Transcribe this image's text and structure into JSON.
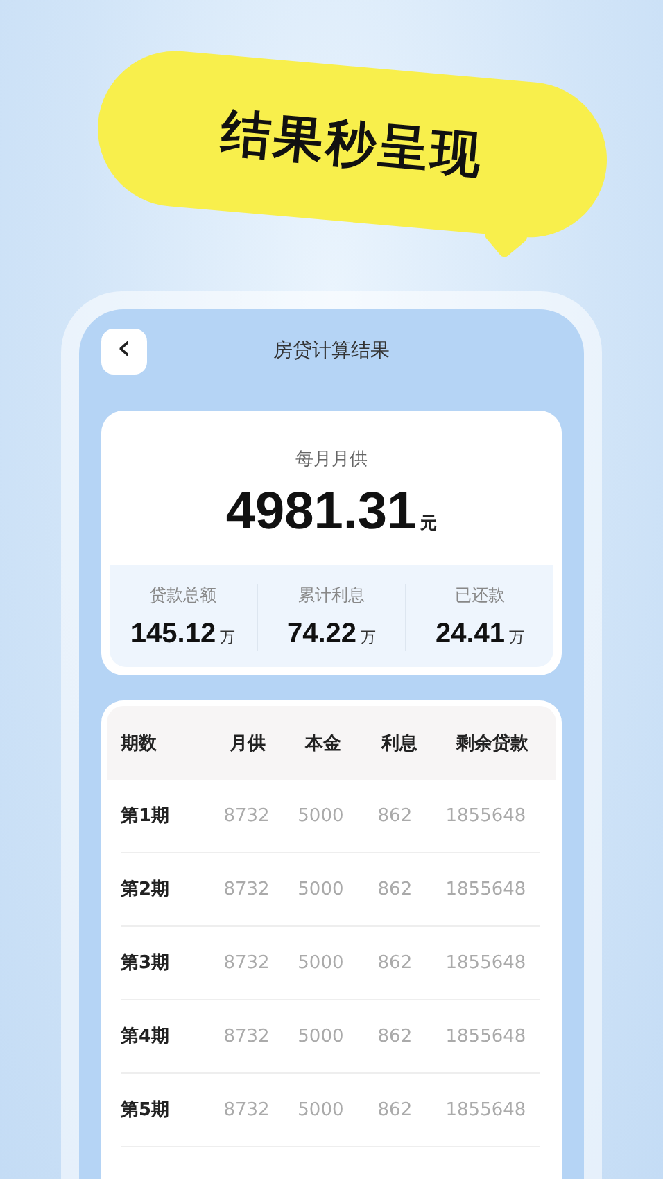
{
  "banner": {
    "headline": "结果秒呈现"
  },
  "header": {
    "back_icon": "‹",
    "title": "房贷计算结果"
  },
  "summary": {
    "label": "每月月供",
    "amount": "4981.31",
    "unit": "元",
    "stats": [
      {
        "label": "贷款总额",
        "value": "145.12",
        "unit": "万"
      },
      {
        "label": "累计利息",
        "value": "74.22",
        "unit": "万"
      },
      {
        "label": "已还款",
        "value": "24.41",
        "unit": "万"
      }
    ]
  },
  "table": {
    "columns": [
      "期数",
      "月供",
      "本金",
      "利息",
      "剩余贷款"
    ],
    "rows": [
      [
        "第1期",
        "8732",
        "5000",
        "862",
        "1855648"
      ],
      [
        "第2期",
        "8732",
        "5000",
        "862",
        "1855648"
      ],
      [
        "第3期",
        "8732",
        "5000",
        "862",
        "1855648"
      ],
      [
        "第4期",
        "8732",
        "5000",
        "862",
        "1855648"
      ],
      [
        "第5期",
        "8732",
        "5000",
        "862",
        "1855648"
      ]
    ]
  }
}
